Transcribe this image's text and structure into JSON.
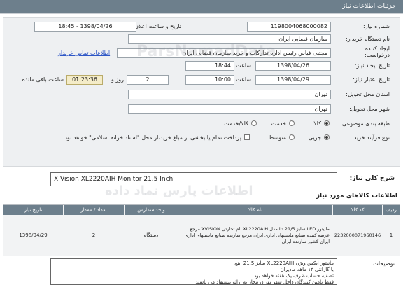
{
  "header": {
    "title": "جزئیات اطلاعات نیاز"
  },
  "form": {
    "need_number_label": "شماره نیاز:",
    "need_number": "1198004068000082",
    "announce_datetime_label": "تاریخ و ساعت اعلان عمومی:",
    "announce_datetime": "1398/04/26 - 18:45",
    "buyer_org_label": "نام دستگاه خریدار:",
    "buyer_org": "سازمان قضایی ایران",
    "creator_label": "ایجاد کننده درخواست:",
    "creator": "مجتبی  فیاض رئیس اداره تدارکات و خرید سازمان قضایی ایران",
    "buyer_contact_link": "اطلاعات تماس خریدار",
    "created_date_label": "تاریخ ایجاد نیاز:",
    "created_date": "1398/04/26",
    "created_time_label": "ساعت",
    "created_time": "18:44",
    "deadline_label": "تاریخ اعتبار نیاز:",
    "deadline_date": "1398/04/29",
    "deadline_time_label": "ساعت",
    "deadline_time": "10:00",
    "days_value": "2",
    "days_label": "روز و",
    "remaining_timer": "01:23:36",
    "remaining_label": "ساعت باقی مانده",
    "province_label": "استان محل تحویل:",
    "province": "تهران",
    "city_label": "شهر محل تحویل:",
    "city": "تهران",
    "category_label": "طبقه بندی موضوعی:",
    "category_options": [
      "کالا",
      "خدمت",
      "کالا/خدمت"
    ],
    "category_selected": "کالا",
    "purchase_type_label": "نوع فرآیند خرید :",
    "purchase_options": [
      "جزیی",
      "متوسط"
    ],
    "purchase_selected": "جزیی",
    "payment_note": "پرداخت تمام یا بخشی از مبلغ خرید،از محل \"اسناد خزانه اسلامی\" خواهد بود."
  },
  "description": {
    "label": "شرح کلی نیاز:",
    "value": "X.Vision XL2220AIH Monitor 21.5 Inch"
  },
  "goods_section_title": "اطلاعات کالاهای مورد نیاز",
  "table": {
    "headers": [
      "ردیف",
      "کد کالا",
      "نام کالا",
      "واحد شمارش",
      "تعداد / مقدار",
      "تاریخ نیاز"
    ],
    "rows": [
      {
        "row": "1",
        "code": "2232000071960146",
        "name": "مانیتور LED سایز 21/5 in مدل XL2220AIH نام تجارتی XVISION مرجع عرضه کننده صنایع ماشینهای اداری ایران مرجع سازنده صنایع ماشینهای اداری ایران کشور سازنده ایران",
        "unit": "دستگاه",
        "qty": "2",
        "date": "1398/04/29"
      }
    ]
  },
  "notes": {
    "label": "توضیحات:",
    "lines": [
      "مانیتور ایکس ویژن XL2220AIH سایز 21.5 اینچ",
      "با گارانتی ۱۲ ماهه مادیران",
      "تصفیه حساب ظرف یک هفته خواهد بود",
      "فقط تامین کنندگان داخل شهر تهران مجاز به ارائه پیشنهاد می باشند"
    ]
  },
  "watermark": {
    "text1": "ParsNamadData",
    "text2": "اطلاعات پارس نماد داده"
  }
}
